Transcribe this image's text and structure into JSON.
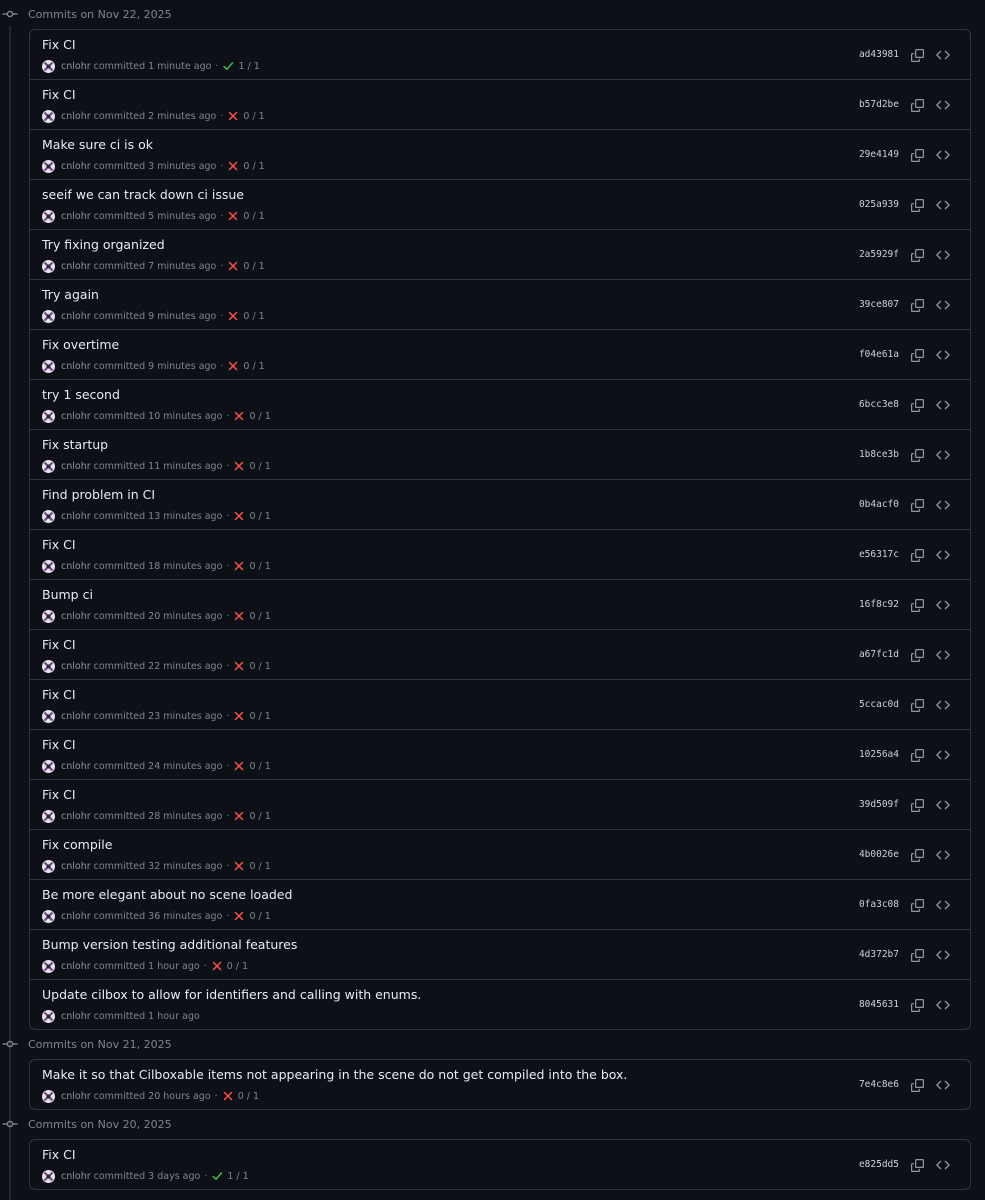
{
  "groups": [
    {
      "date": "Commits on Nov 22, 2025",
      "commits": [
        {
          "message": "Fix CI",
          "author": "cnlohr",
          "time": "committed 1 minute ago",
          "status": "success",
          "checks": "1 / 1",
          "sha": "ad43981"
        },
        {
          "message": "Fix CI",
          "author": "cnlohr",
          "time": "committed 2 minutes ago",
          "status": "failure",
          "checks": "0 / 1",
          "sha": "b57d2be"
        },
        {
          "message": "Make sure ci is ok",
          "author": "cnlohr",
          "time": "committed 3 minutes ago",
          "status": "failure",
          "checks": "0 / 1",
          "sha": "29e4149"
        },
        {
          "message": "seeif we can track down ci issue",
          "author": "cnlohr",
          "time": "committed 5 minutes ago",
          "status": "failure",
          "checks": "0 / 1",
          "sha": "025a939"
        },
        {
          "message": "Try fixing organized",
          "author": "cnlohr",
          "time": "committed 7 minutes ago",
          "status": "failure",
          "checks": "0 / 1",
          "sha": "2a5929f"
        },
        {
          "message": "Try again",
          "author": "cnlohr",
          "time": "committed 9 minutes ago",
          "status": "failure",
          "checks": "0 / 1",
          "sha": "39ce807"
        },
        {
          "message": "Fix overtime",
          "author": "cnlohr",
          "time": "committed 9 minutes ago",
          "status": "failure",
          "checks": "0 / 1",
          "sha": "f04e61a"
        },
        {
          "message": "try 1 second",
          "author": "cnlohr",
          "time": "committed 10 minutes ago",
          "status": "failure",
          "checks": "0 / 1",
          "sha": "6bcc3e8"
        },
        {
          "message": "Fix startup",
          "author": "cnlohr",
          "time": "committed 11 minutes ago",
          "status": "failure",
          "checks": "0 / 1",
          "sha": "1b8ce3b"
        },
        {
          "message": "Find problem in CI",
          "author": "cnlohr",
          "time": "committed 13 minutes ago",
          "status": "failure",
          "checks": "0 / 1",
          "sha": "0b4acf0"
        },
        {
          "message": "Fix CI",
          "author": "cnlohr",
          "time": "committed 18 minutes ago",
          "status": "failure",
          "checks": "0 / 1",
          "sha": "e56317c"
        },
        {
          "message": "Bump ci",
          "author": "cnlohr",
          "time": "committed 20 minutes ago",
          "status": "failure",
          "checks": "0 / 1",
          "sha": "16f8c92"
        },
        {
          "message": "Fix CI",
          "author": "cnlohr",
          "time": "committed 22 minutes ago",
          "status": "failure",
          "checks": "0 / 1",
          "sha": "a67fc1d"
        },
        {
          "message": "Fix CI",
          "author": "cnlohr",
          "time": "committed 23 minutes ago",
          "status": "failure",
          "checks": "0 / 1",
          "sha": "5ccac0d"
        },
        {
          "message": "Fix CI",
          "author": "cnlohr",
          "time": "committed 24 minutes ago",
          "status": "failure",
          "checks": "0 / 1",
          "sha": "10256a4"
        },
        {
          "message": "Fix CI",
          "author": "cnlohr",
          "time": "committed 28 minutes ago",
          "status": "failure",
          "checks": "0 / 1",
          "sha": "39d509f"
        },
        {
          "message": "Fix compile",
          "author": "cnlohr",
          "time": "committed 32 minutes ago",
          "status": "failure",
          "checks": "0 / 1",
          "sha": "4b0026e"
        },
        {
          "message": "Be more elegant about no scene loaded",
          "author": "cnlohr",
          "time": "committed 36 minutes ago",
          "status": "failure",
          "checks": "0 / 1",
          "sha": "0fa3c08"
        },
        {
          "message": "Bump version testing additional features",
          "author": "cnlohr",
          "time": "committed 1 hour ago",
          "status": "failure",
          "checks": "0 / 1",
          "sha": "4d372b7"
        },
        {
          "message": "Update cilbox to allow for identifiers and calling with enums.",
          "author": "cnlohr",
          "time": "committed 1 hour ago",
          "status": "none",
          "checks": "",
          "sha": "8045631"
        }
      ]
    },
    {
      "date": "Commits on Nov 21, 2025",
      "commits": [
        {
          "message": "Make it so that Cilboxable items not appearing in the scene do not get compiled into the box.",
          "author": "cnlohr",
          "time": "committed 20 hours ago",
          "status": "failure",
          "checks": "0 / 1",
          "sha": "7e4c8e6"
        }
      ]
    },
    {
      "date": "Commits on Nov 20, 2025",
      "commits": [
        {
          "message": "Fix CI",
          "author": "cnlohr",
          "time": "committed 3 days ago",
          "status": "success",
          "checks": "1 / 1",
          "sha": "e825dd5"
        }
      ]
    }
  ],
  "colors": {
    "success": "#3fb950",
    "failure": "#f85149",
    "icon": "#9198a1"
  },
  "icons": {
    "timeline": "git-commit-icon",
    "copy": "copy-icon",
    "browse": "code-icon",
    "success": "check-icon",
    "failure": "x-icon"
  }
}
